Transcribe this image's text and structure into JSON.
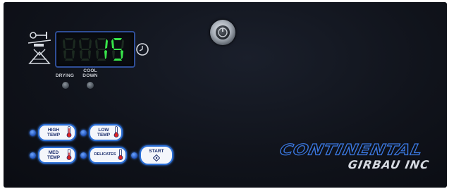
{
  "display": {
    "digits": "8815",
    "lit_digits": "15",
    "color_on": "#38e44a",
    "color_off": "#1c2a20"
  },
  "indicators": [
    {
      "label_line1": "DRYING",
      "label_line2": ""
    },
    {
      "label_line1": "COOL",
      "label_line2": "DOWN"
    }
  ],
  "buttons": {
    "high_temp": {
      "line1": "HIGH",
      "line2": "TEMP"
    },
    "low_temp": {
      "line1": "LOW",
      "line2": "TEMP"
    },
    "med_temp": {
      "line1": "MED",
      "line2": "TEMP"
    },
    "delicates": {
      "line1": "DELICATES",
      "line2": ""
    },
    "start": {
      "line1": "START",
      "line2": ""
    }
  },
  "brand": {
    "name": "CONTINENTAL",
    "maker": "GIRBAU INC"
  },
  "icons": [
    "tumble-mode-icon",
    "clock-icon",
    "key-lock-icon",
    "thermometer-icon",
    "start-icon"
  ],
  "colors": {
    "accent": "#2b6fd6",
    "face": "#10131b"
  }
}
